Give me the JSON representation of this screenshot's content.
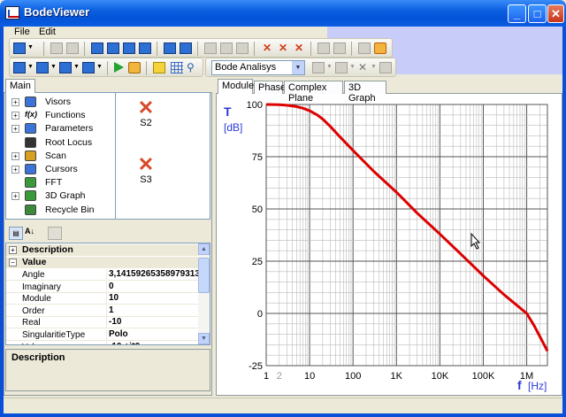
{
  "window": {
    "title": "BodeViewer",
    "minimize": "_",
    "maximize": "□",
    "close": "✕"
  },
  "menu": [
    "File",
    "Edit"
  ],
  "toolbar": {
    "analysis_combo": "Bode Analisys"
  },
  "left_tabs": {
    "main": "Main"
  },
  "tree": {
    "items": [
      {
        "label": "Visors",
        "expandable": true,
        "icon": "visors-icon"
      },
      {
        "label": "Functions",
        "expandable": true,
        "icon": "functions-icon",
        "icon_text": "f(x)"
      },
      {
        "label": "Parameters",
        "expandable": true,
        "icon": "parameters-icon"
      },
      {
        "label": "Root Locus",
        "expandable": false,
        "icon": "root-locus-icon"
      },
      {
        "label": "Scan",
        "expandable": true,
        "icon": "scan-icon"
      },
      {
        "label": "Cursors",
        "expandable": true,
        "icon": "cursors-icon"
      },
      {
        "label": "FFT",
        "expandable": false,
        "icon": "fft-icon"
      },
      {
        "label": "3D Graph",
        "expandable": true,
        "icon": "3d-graph-icon"
      },
      {
        "label": "Recycle Bin",
        "expandable": false,
        "icon": "recycle-bin-icon"
      }
    ],
    "singularities": [
      "S2",
      "S3"
    ]
  },
  "properties": {
    "category_description": "Description",
    "category_value": "Value",
    "rows": [
      {
        "name": "Angle",
        "value": "3,14159265358979313"
      },
      {
        "name": "Imaginary",
        "value": "0"
      },
      {
        "name": "Module",
        "value": "10"
      },
      {
        "name": "Order",
        "value": "1"
      },
      {
        "name": "Real",
        "value": "-10"
      },
      {
        "name": "SingularitieType",
        "value": "Polo"
      },
      {
        "name": "Value",
        "value": "-10 +i*0"
      }
    ]
  },
  "description": {
    "title": "Description"
  },
  "plot_tabs": [
    "Module",
    "Phase",
    "Complex Plane",
    "3D Graph"
  ],
  "chart_data": {
    "type": "line",
    "title": "",
    "ylabel_symbol": "T",
    "ylabel_unit": "[dB]",
    "xlabel_symbol": "f",
    "xlabel_unit": "[Hz]",
    "x_scale": "log",
    "xlim": [
      1,
      3000000
    ],
    "ylim": [
      -25,
      100
    ],
    "yticks": [
      100,
      75,
      50,
      25,
      0,
      -25
    ],
    "xtick_labels": [
      "1",
      "2",
      "10",
      "100",
      "1K",
      "10K",
      "100K",
      "1M"
    ],
    "xtick_values": [
      1,
      2,
      10,
      100,
      1000,
      10000,
      100000,
      1000000
    ],
    "grid": true,
    "line_color": "#dd0000",
    "series": [
      {
        "x": [
          1,
          2,
          3,
          5,
          7,
          10,
          15,
          20,
          30,
          50,
          100,
          300,
          1000,
          3000,
          10000,
          30000,
          100000,
          300000,
          1000000,
          1500000,
          2000000,
          3000000
        ],
        "values": [
          100,
          99.9,
          99.6,
          99,
          98.2,
          97,
          95,
          93,
          89.5,
          84.5,
          78,
          68,
          58,
          48,
          38,
          28.5,
          18,
          9,
          0,
          -6,
          -11,
          -18
        ]
      }
    ]
  }
}
